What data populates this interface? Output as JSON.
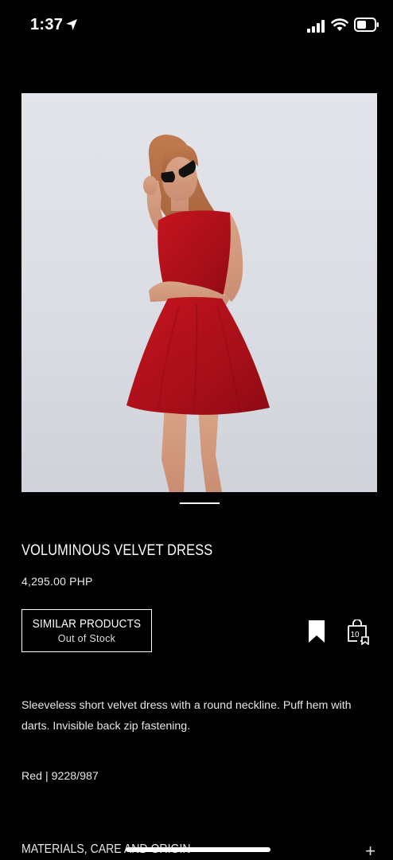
{
  "status_bar": {
    "time": "1:37"
  },
  "product": {
    "title": "VOLUMINOUS VELVET DRESS",
    "price": "4,295.00 PHP",
    "description": "Sleeveless short velvet dress with a round neckline. Puff hem with darts. Invisible back zip fastening.",
    "color_ref": "Red | 9228/987"
  },
  "similar": {
    "title": "SIMILAR PRODUCTS",
    "subtitle": "Out of Stock"
  },
  "actions": {
    "bag_count": "10"
  },
  "sections": {
    "materials_label": "MATERIALS, CARE AND ORIGIN",
    "expand_symbol": "+"
  },
  "icons": {
    "location": "location-arrow-icon",
    "signal": "signal-icon",
    "wifi": "wifi-icon",
    "battery": "battery-icon",
    "bookmark": "bookmark-icon",
    "bag": "shopping-bag-icon",
    "plus": "plus-icon"
  },
  "colors": {
    "background": "#000000",
    "text": "#ffffff",
    "dress_red": "#b5121b"
  }
}
